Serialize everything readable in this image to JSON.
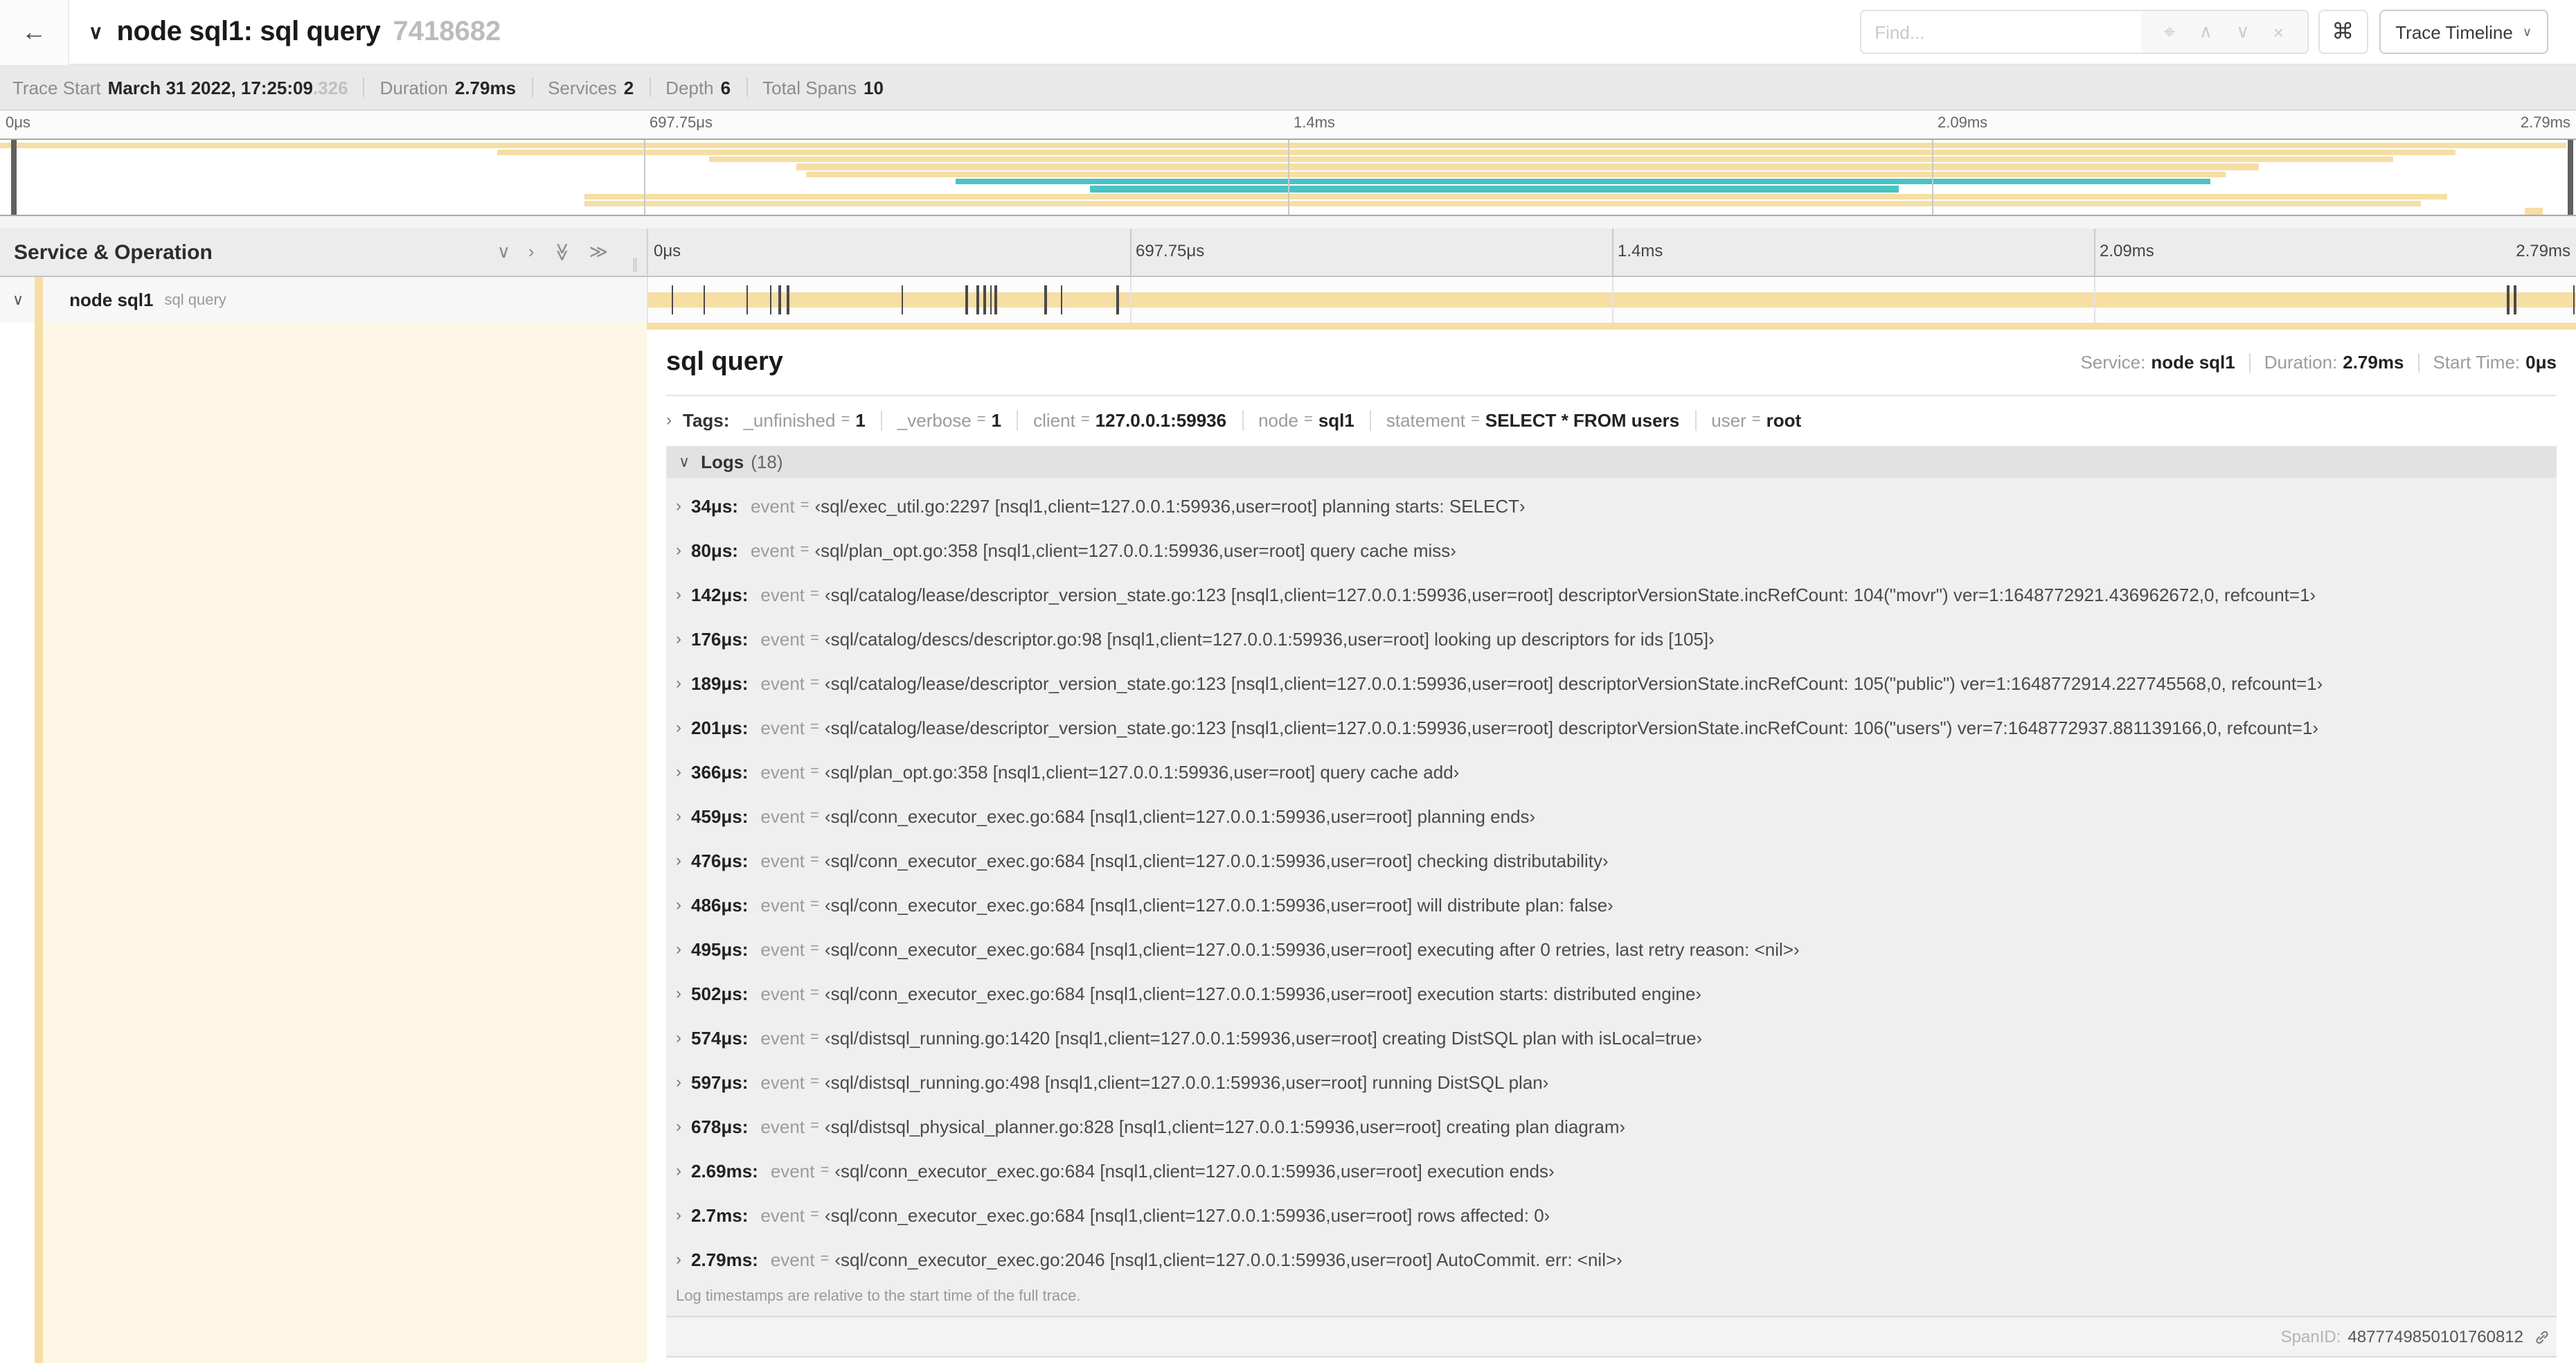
{
  "header": {
    "back_icon": "←",
    "collapse_icon": "∨",
    "title": "node sql1: sql query",
    "trace_id": "7418682",
    "find_placeholder": "Find...",
    "find_icons": [
      "⌖",
      "∧",
      "∨",
      "×"
    ],
    "shortcuts_icon": "⌘",
    "view_label": "Trace Timeline",
    "view_caret": "∨"
  },
  "summary": {
    "items": [
      {
        "label": "Trace Start",
        "value": "March 31 2022, 17:25:09",
        "extra": ".326"
      },
      {
        "label": "Duration",
        "value": "2.79ms"
      },
      {
        "label": "Services",
        "value": "2"
      },
      {
        "label": "Depth",
        "value": "6"
      },
      {
        "label": "Total Spans",
        "value": "10"
      }
    ]
  },
  "minimap": {
    "ticks": [
      {
        "label": "0μs",
        "pct": 0
      },
      {
        "label": "697.75μs",
        "pct": 25
      },
      {
        "label": "1.4ms",
        "pct": 50
      },
      {
        "label": "2.09ms",
        "pct": 75
      },
      {
        "label": "2.79ms",
        "pct": 100
      }
    ],
    "spans": [
      {
        "start": 0,
        "end": 99.6,
        "color": "tan"
      },
      {
        "start": 19.3,
        "end": 95.3,
        "color": "tan"
      },
      {
        "start": 27.5,
        "end": 92.9,
        "color": "tan"
      },
      {
        "start": 30.9,
        "end": 87.7,
        "color": "tan"
      },
      {
        "start": 31.3,
        "end": 86.4,
        "color": "tan"
      },
      {
        "start": 37.1,
        "end": 85.8,
        "color": "teal"
      },
      {
        "start": 42.3,
        "end": 73.7,
        "color": "teal"
      },
      {
        "start": 22.7,
        "end": 95.0,
        "color": "tan"
      },
      {
        "start": 22.7,
        "end": 94.0,
        "color": "tan"
      },
      {
        "start": 98.0,
        "end": 98.7,
        "color": "tan"
      }
    ]
  },
  "timeline": {
    "header_title": "Service & Operation",
    "collapse_icons": [
      "∨",
      "›",
      "≫",
      "≫"
    ],
    "grip_icon": "∥",
    "total_us": 2790,
    "gridlines_pct": [
      25,
      50,
      75
    ],
    "ticks": [
      {
        "label": "0μs",
        "pct": 0
      },
      {
        "label": "697.75μs",
        "pct": 25
      },
      {
        "label": "1.4ms",
        "pct": 50
      },
      {
        "label": "2.09ms",
        "pct": 75
      },
      {
        "label": "2.79ms",
        "pct": 100
      }
    ]
  },
  "span_row": {
    "collapse_icon": "∨",
    "service": "node sql1",
    "operation": "sql query"
  },
  "detail": {
    "title": "sql query",
    "overview": {
      "service_label": "Service:",
      "service": "node sql1",
      "duration_label": "Duration:",
      "duration": "2.79ms",
      "start_label": "Start Time:",
      "start": "0μs"
    },
    "tags": {
      "toggle_icon": "›",
      "label": "Tags:",
      "items": [
        {
          "key": "_unfinished",
          "value": "1"
        },
        {
          "key": "_verbose",
          "value": "1"
        },
        {
          "key": "client",
          "value": "127.0.0.1:59936"
        },
        {
          "key": "node",
          "value": "sql1"
        },
        {
          "key": "statement",
          "value": "SELECT * FROM users"
        },
        {
          "key": "user",
          "value": "root"
        }
      ]
    },
    "logs": {
      "toggle_icon": "∨",
      "label": "Logs",
      "count": "(18)",
      "row_toggle_icon": "›",
      "event_key": "event",
      "entries": [
        {
          "ts": "34μs",
          "us": 34,
          "value": "‹sql/exec_util.go:2297 [nsql1,client=127.0.0.1:59936,user=root] planning starts: SELECT›"
        },
        {
          "ts": "80μs",
          "us": 80,
          "value": "‹sql/plan_opt.go:358 [nsql1,client=127.0.0.1:59936,user=root] query cache miss›"
        },
        {
          "ts": "142μs",
          "us": 142,
          "value": "‹sql/catalog/lease/descriptor_version_state.go:123 [nsql1,client=127.0.0.1:59936,user=root] descriptorVersionState.incRefCount: 104(\"movr\") ver=1:1648772921.436962672,0, refcount=1›"
        },
        {
          "ts": "176μs",
          "us": 176,
          "value": "‹sql/catalog/descs/descriptor.go:98 [nsql1,client=127.0.0.1:59936,user=root] looking up descriptors for ids [105]›"
        },
        {
          "ts": "189μs",
          "us": 189,
          "value": "‹sql/catalog/lease/descriptor_version_state.go:123 [nsql1,client=127.0.0.1:59936,user=root] descriptorVersionState.incRefCount: 105(\"public\") ver=1:1648772914.227745568,0, refcount=1›"
        },
        {
          "ts": "201μs",
          "us": 201,
          "value": "‹sql/catalog/lease/descriptor_version_state.go:123 [nsql1,client=127.0.0.1:59936,user=root] descriptorVersionState.incRefCount: 106(\"users\") ver=7:1648772937.881139166,0, refcount=1›"
        },
        {
          "ts": "366μs",
          "us": 366,
          "value": "‹sql/plan_opt.go:358 [nsql1,client=127.0.0.1:59936,user=root] query cache add›"
        },
        {
          "ts": "459μs",
          "us": 459,
          "value": "‹sql/conn_executor_exec.go:684 [nsql1,client=127.0.0.1:59936,user=root] planning ends›"
        },
        {
          "ts": "476μs",
          "us": 476,
          "value": "‹sql/conn_executor_exec.go:684 [nsql1,client=127.0.0.1:59936,user=root] checking distributability›"
        },
        {
          "ts": "486μs",
          "us": 486,
          "value": "‹sql/conn_executor_exec.go:684 [nsql1,client=127.0.0.1:59936,user=root] will distribute plan: false›"
        },
        {
          "ts": "495μs",
          "us": 495,
          "value": "‹sql/conn_executor_exec.go:684 [nsql1,client=127.0.0.1:59936,user=root] executing after 0 retries, last retry reason: <nil>›"
        },
        {
          "ts": "502μs",
          "us": 502,
          "value": "‹sql/conn_executor_exec.go:684 [nsql1,client=127.0.0.1:59936,user=root] execution starts: distributed engine›"
        },
        {
          "ts": "574μs",
          "us": 574,
          "value": "‹sql/distsql_running.go:1420 [nsql1,client=127.0.0.1:59936,user=root] creating DistSQL plan with isLocal=true›"
        },
        {
          "ts": "597μs",
          "us": 597,
          "value": "‹sql/distsql_running.go:498 [nsql1,client=127.0.0.1:59936,user=root] running DistSQL plan›"
        },
        {
          "ts": "678μs",
          "us": 678,
          "value": "‹sql/distsql_physical_planner.go:828 [nsql1,client=127.0.0.1:59936,user=root] creating plan diagram›"
        },
        {
          "ts": "2.69ms",
          "us": 2690,
          "value": "‹sql/conn_executor_exec.go:684 [nsql1,client=127.0.0.1:59936,user=root] execution ends›"
        },
        {
          "ts": "2.7ms",
          "us": 2700,
          "value": "‹sql/conn_executor_exec.go:684 [nsql1,client=127.0.0.1:59936,user=root] rows affected: 0›"
        },
        {
          "ts": "2.79ms",
          "us": 2790,
          "value": "‹sql/conn_executor_exec.go:2046 [nsql1,client=127.0.0.1:59936,user=root] AutoCommit. err: <nil>›"
        }
      ],
      "note": "Log timestamps are relative to the start time of the full trace."
    },
    "footer": {
      "label": "SpanID:",
      "value": "4877749850101760812"
    }
  },
  "colors": {
    "tan": "#f6dea4",
    "teal": "#4bc3c3",
    "cream": "#fdf6e4"
  }
}
